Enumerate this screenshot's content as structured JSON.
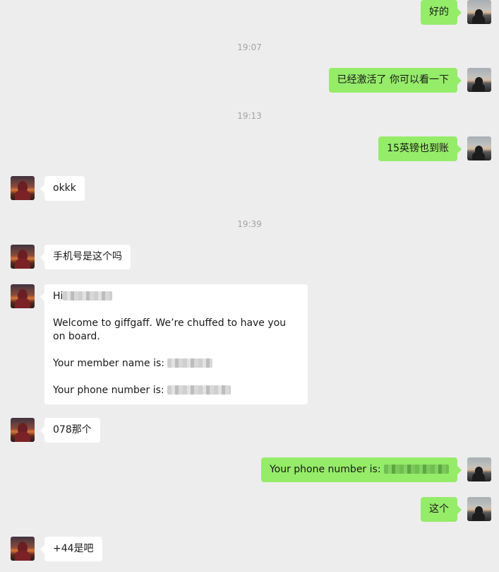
{
  "chat": {
    "timestamps": [
      "19:07",
      "19:13",
      "19:39"
    ],
    "messages": [
      {
        "side": "me",
        "text": "好的"
      },
      {
        "side": "me",
        "text": "已经激活了 你可以看一下"
      },
      {
        "side": "me",
        "text": "15英镑也到账"
      },
      {
        "side": "other",
        "text": "okkk"
      },
      {
        "side": "other",
        "text": "手机号是这个吗"
      },
      {
        "side": "other",
        "greeting": "Hi",
        "welcome": "Welcome to giffgaff. We’re chuffed to have you on board.",
        "member_label": "Your member name is:",
        "phone_label": "Your phone number is:"
      },
      {
        "side": "other",
        "text": "078那个"
      },
      {
        "side": "me",
        "text": "Your phone number is:"
      },
      {
        "side": "me",
        "text": "这个"
      },
      {
        "side": "other",
        "text": "+44是吧"
      }
    ]
  },
  "colors": {
    "background": "#ededed",
    "my_bubble": "#95ec69",
    "their_bubble": "#ffffff",
    "timestamp": "#a3a3a3"
  }
}
